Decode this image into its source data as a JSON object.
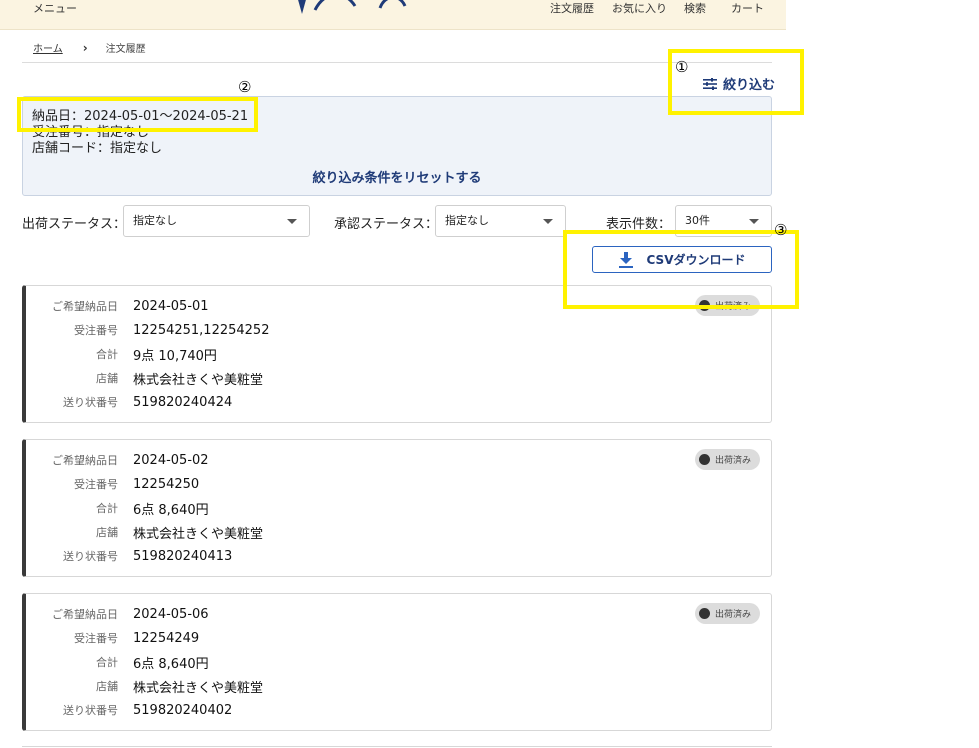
{
  "header": {
    "menu_label": "メニュー",
    "nav": [
      "注文履歴",
      "お気に入り",
      "検索",
      "カート"
    ]
  },
  "breadcrumb": {
    "home": "ホーム",
    "current": "注文履歴"
  },
  "filter_link_label": "絞り込む",
  "conditions": {
    "delivery_date": "納品日：2024-05-01～2024-05-21",
    "order_number": "受注番号：指定なし",
    "store_code": "店舗コード：指定なし",
    "reset_label": "絞り込み条件をリセットする"
  },
  "filters": {
    "shipping_status_label": "出荷ステータス：",
    "shipping_status_value": "指定なし",
    "approval_status_label": "承認ステータス：",
    "approval_status_value": "指定なし",
    "page_size_label": "表示件数：",
    "page_size_value": "30件"
  },
  "csv_button_label": "CSVダウンロード",
  "field_labels": {
    "date": "ご希望納品日",
    "order_no": "受注番号",
    "total": "合計",
    "store": "店舗",
    "tracking": "送り状番号"
  },
  "orders": [
    {
      "date": "2024-05-01",
      "order_no": "12254251,12254252",
      "total": "9点 10,740円",
      "store": "株式会社きくや美粧堂",
      "tracking": "519820240424",
      "status": "出荷済み"
    },
    {
      "date": "2024-05-02",
      "order_no": "12254250",
      "total": "6点 8,640円",
      "store": "株式会社きくや美粧堂",
      "tracking": "519820240413",
      "status": "出荷済み"
    },
    {
      "date": "2024-05-06",
      "order_no": "12254249",
      "total": "6点 8,640円",
      "store": "株式会社きくや美粧堂",
      "tracking": "519820240402",
      "status": "出荷済み"
    }
  ],
  "annotations": [
    "①",
    "②",
    "③"
  ],
  "colors": {
    "accent": "#1f3b78",
    "highlight": "#fff200",
    "header_bg": "#fbf4e1",
    "panel_bg": "#eff3f9"
  }
}
